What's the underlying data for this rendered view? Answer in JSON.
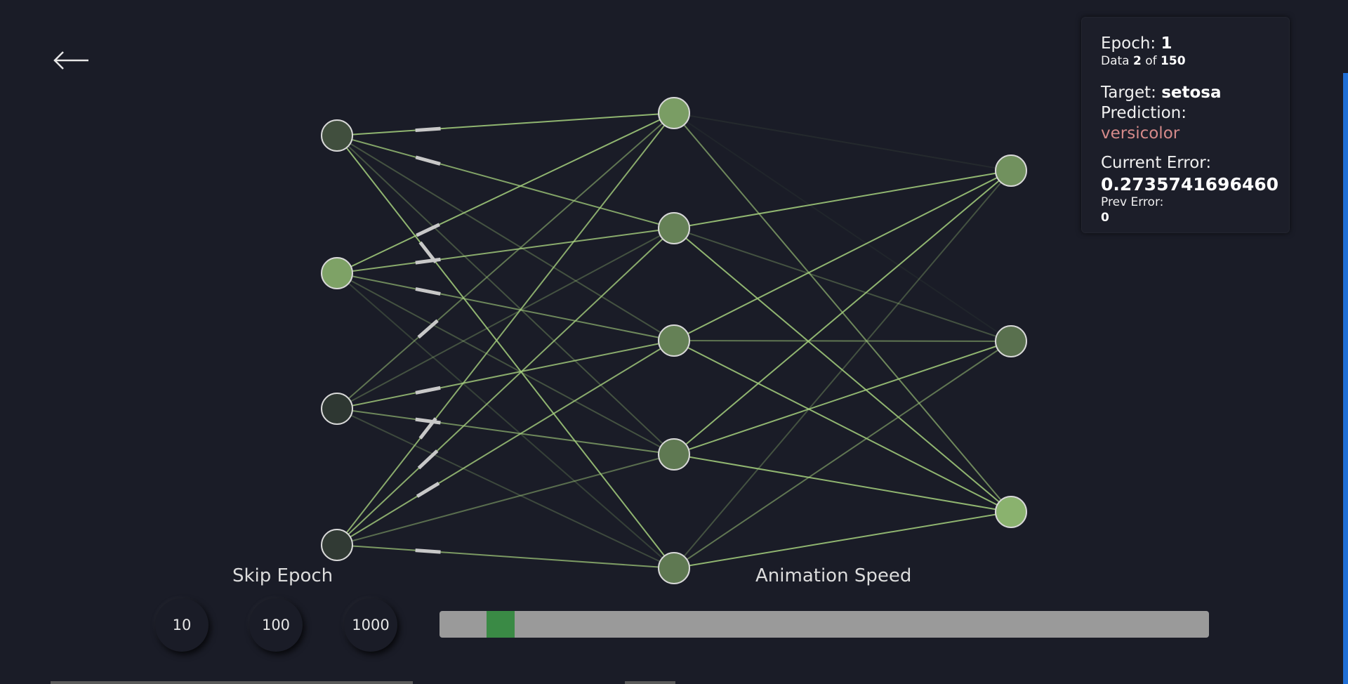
{
  "colors": {
    "background": "#1a1c27",
    "connection": "#a6d07e",
    "prediction_wrong": "#d58a8a",
    "speed_thumb": "#3a8a45",
    "speed_track": "#9a9a9a",
    "scrollbar": "#1f6fd6"
  },
  "icons": {
    "back": "left-arrow-icon"
  },
  "info": {
    "epoch_label": "Epoch: ",
    "epoch_value": "1",
    "data_label": "Data ",
    "data_index": "2",
    "data_of": " of ",
    "data_total": "150",
    "target_label": "Target: ",
    "target_value": "setosa",
    "prediction_label": "Prediction: ",
    "prediction_value": "versicolor",
    "current_error_label": "Current Error:",
    "current_error_value": "0.2735741696460",
    "prev_error_label": "Prev Error:",
    "prev_error_value": "0"
  },
  "controls": {
    "skip_epoch_label": "Skip Epoch",
    "skip_buttons": [
      "10",
      "100",
      "1000"
    ],
    "animation_speed_label": "Animation Speed",
    "animation_speed_value": 0.04
  },
  "network": {
    "layers": [
      {
        "activations": [
          0.25,
          0.75,
          0.1,
          0.12
        ]
      },
      {
        "activations": [
          0.72,
          0.55,
          0.55,
          0.5,
          0.5
        ]
      },
      {
        "activations": [
          0.65,
          0.45,
          0.85
        ]
      }
    ],
    "weights": [
      [
        [
          0.85,
          0.75,
          0.3,
          0.3,
          0.85
        ],
        [
          0.85,
          0.8,
          0.6,
          0.3,
          0.2
        ],
        [
          0.5,
          0.3,
          0.8,
          0.6,
          0.25
        ],
        [
          0.8,
          0.8,
          0.8,
          0.45,
          0.7
        ]
      ],
      [
        [
          0.08,
          0.05,
          0.6
        ],
        [
          0.85,
          0.3,
          0.85
        ],
        [
          0.85,
          0.5,
          0.85
        ],
        [
          0.85,
          0.85,
          0.85
        ],
        [
          0.3,
          0.5,
          0.85
        ]
      ]
    ],
    "active_edge_markers": 13
  }
}
